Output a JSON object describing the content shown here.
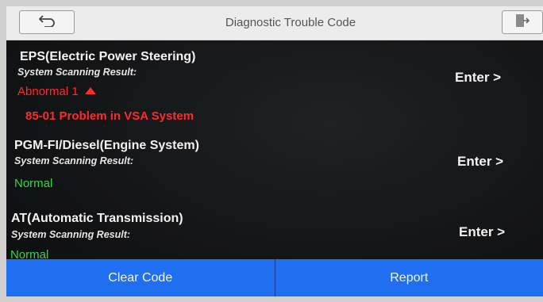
{
  "header": {
    "title": "Diagnostic Trouble Code",
    "back_icon": "back-arrow-icon",
    "exit_icon": "exit-icon"
  },
  "systems": [
    {
      "name": "EPS(Electric Power Steering)",
      "scan_label": "System Scanning Result:",
      "status": "Abnormal 1",
      "codes": [
        "85-01 Problem in VSA System"
      ],
      "enter_label": "Enter >"
    },
    {
      "name": "PGM-FI/Diesel(Engine System)",
      "scan_label": "System Scanning Result:",
      "status": "Normal",
      "enter_label": "Enter >"
    },
    {
      "name": "AT(Automatic Transmission)",
      "scan_label": "System Scanning Result:",
      "status": "Normal",
      "enter_label": "Enter >"
    }
  ],
  "footer": {
    "clear_label": "Clear Code",
    "report_label": "Report"
  },
  "colors": {
    "accent": "#1f6ff0",
    "abnormal": "#ff2a2a",
    "normal": "#2fd84a"
  }
}
